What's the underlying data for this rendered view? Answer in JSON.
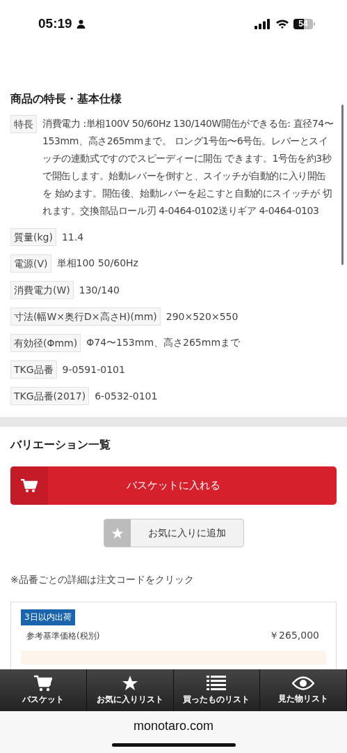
{
  "status_bar": {
    "time": "05:19",
    "battery": "54"
  },
  "specs": {
    "title": "商品の特長・基本仕様",
    "feature": {
      "label": "特長",
      "text": "消費電力 :単相100V 50/60Hz 130/140W開缶ができる缶: 直径74〜153mm、高さ265mmまで。 ロング1号缶〜6号缶。レバーとスイッチの連動式ですのでスピーディーに開缶 できます。1号缶を約3秒で開缶します。始動レバーを倒すと、スイッチが自動的に入り開缶を 始めます。開缶後、始動レバーを起こすと自動的にスイッチが 切れます。交換部品ロール刃 4-0464-0102送りギア 4-0464-0103"
    },
    "rows": [
      {
        "label": "質量(kg)",
        "value": "11.4"
      },
      {
        "label": "電源(V)",
        "value": "単相100 50/60Hz"
      },
      {
        "label": "消費電力(W)",
        "value": "130/140"
      },
      {
        "label": "寸法(幅W×奥行D×高さH)(mm)",
        "value": "290×520×550"
      },
      {
        "label": "有効径(Φmm)",
        "value": "Φ74〜153mm、高さ265mmまで"
      },
      {
        "label": "TKG品番",
        "value": "9-0591-0101"
      },
      {
        "label": "TKG品番(2017)",
        "value": "6-0532-0101"
      }
    ]
  },
  "variations": {
    "title": "バリエーション一覧",
    "basket_button": "バスケットに入れる",
    "favorite_button": "お気に入りに追加",
    "note": "※品番ごとの詳細は注文コードをクリック",
    "card": {
      "badge": "3日以内出荷",
      "price_label": "参考基準価格(税別)",
      "price": "￥265,000"
    }
  },
  "tab_bar": [
    {
      "kind": "cart",
      "label": "バスケット"
    },
    {
      "kind": "star",
      "label": "お気に入りリスト"
    },
    {
      "kind": "list",
      "label": "買ったものリスト"
    },
    {
      "kind": "eye",
      "label": "見た物リスト"
    }
  ],
  "browser": {
    "url": "monotaro.com"
  }
}
